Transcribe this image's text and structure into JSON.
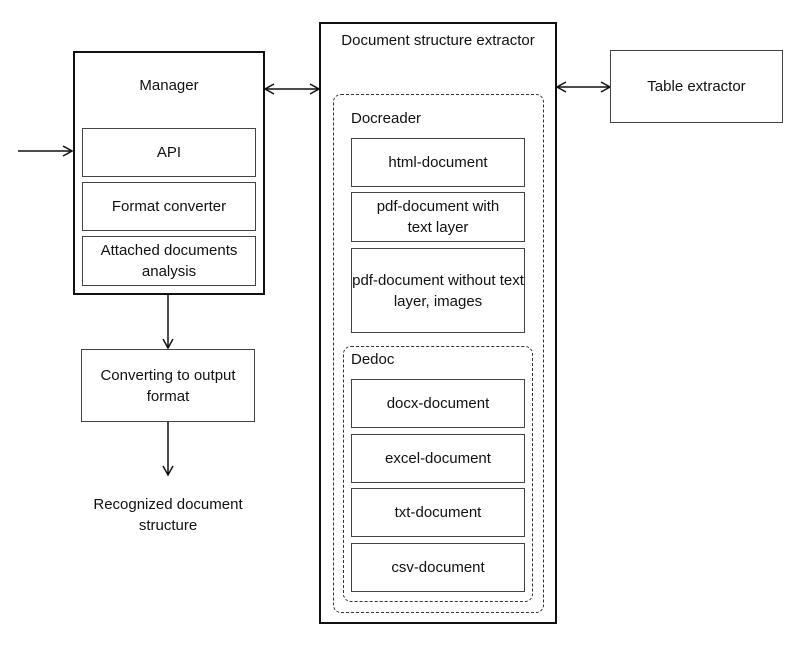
{
  "manager": {
    "title": "Manager",
    "modules": [
      "API",
      "Format converter",
      "Attached documents analysis"
    ]
  },
  "converter": {
    "label": "Converting to output format"
  },
  "output": {
    "label": "Recognized document structure"
  },
  "extractor": {
    "title": "Document structure extractor",
    "docreader": {
      "title": "Docreader",
      "items": [
        "html-document",
        "pdf-document with text layer",
        "pdf-document without text layer, images"
      ]
    },
    "dedoc": {
      "title": "Dedoc",
      "items": [
        "docx-document",
        "excel-document",
        "txt-document",
        "csv-document"
      ]
    }
  },
  "table_extractor": {
    "label": "Table extractor"
  }
}
